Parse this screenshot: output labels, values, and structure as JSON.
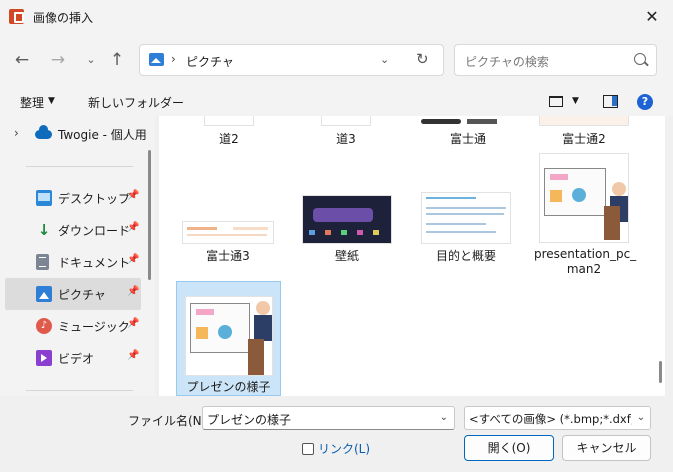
{
  "window": {
    "title": "画像の挿入",
    "close_glyph": "✕"
  },
  "nav": {
    "back_glyph": "←",
    "forward_glyph": "→",
    "recent_glyph": "⌄",
    "up_glyph": "↑",
    "address": {
      "separator": "›",
      "location": "ピクチャ",
      "dropdown_glyph": "⌄",
      "refresh_glyph": "↻"
    },
    "search": {
      "placeholder": "ピクチャの検索"
    }
  },
  "toolbar": {
    "organize_label": "整理",
    "organize_caret": "▼",
    "new_folder_label": "新しいフォルダー",
    "view_caret": "▼",
    "help_glyph": "?"
  },
  "sidebar": {
    "tree_item": {
      "chevron": "›",
      "label": "Twogie - 個人用"
    },
    "items": [
      {
        "label": "デスクトップ",
        "icon": "desktop-icon",
        "pinned": true
      },
      {
        "label": "ダウンロード",
        "icon": "download-icon",
        "pinned": true
      },
      {
        "label": "ドキュメント",
        "icon": "documents-icon",
        "pinned": true
      },
      {
        "label": "ピクチャ",
        "icon": "pictures-icon",
        "pinned": true,
        "selected": true
      },
      {
        "label": "ミュージック",
        "icon": "music-icon",
        "pinned": true
      },
      {
        "label": "ビデオ",
        "icon": "video-icon",
        "pinned": true
      }
    ],
    "pin_glyph": "📌",
    "music_glyph": "♪",
    "download_glyph": "↓"
  },
  "files": [
    {
      "name": "道2"
    },
    {
      "name": "道3"
    },
    {
      "name": "富士通"
    },
    {
      "name": "富士通2"
    },
    {
      "name": "富士通3"
    },
    {
      "name": "壁紙"
    },
    {
      "name": "目的と概要"
    },
    {
      "name": "presentation_pc_\nman2"
    },
    {
      "name": "プレゼンの様子",
      "selected": true
    }
  ],
  "footer": {
    "filename_label": "ファイル名(N):",
    "filename_value": "プレゼンの様子",
    "dropdown_glyph": "⌄",
    "filter_value": "<すべての画像> (*.bmp;*.dxf;*.e",
    "link_label": "リンク(L)",
    "open_label": "開く(O)",
    "cancel_label": "キャンセル"
  },
  "colors": {
    "accent": "#0067c0",
    "selection": "#cce4f7",
    "selection_border": "#99c9ef"
  }
}
